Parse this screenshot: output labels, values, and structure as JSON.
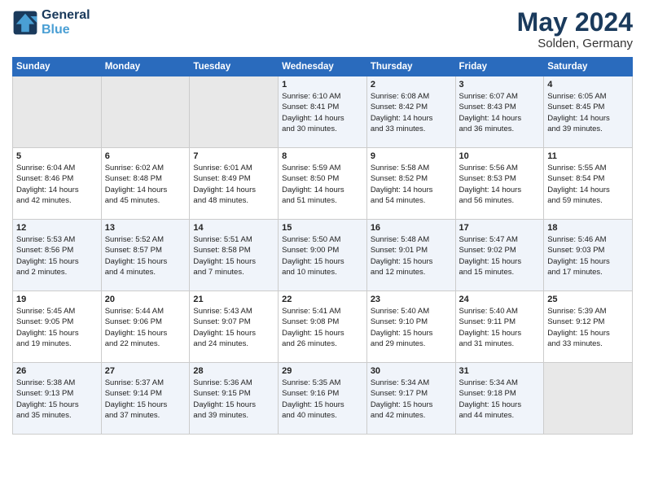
{
  "header": {
    "logo_line1": "General",
    "logo_line2": "Blue",
    "month": "May 2024",
    "location": "Solden, Germany"
  },
  "weekdays": [
    "Sunday",
    "Monday",
    "Tuesday",
    "Wednesday",
    "Thursday",
    "Friday",
    "Saturday"
  ],
  "rows": [
    [
      {
        "day": "",
        "text": ""
      },
      {
        "day": "",
        "text": ""
      },
      {
        "day": "",
        "text": ""
      },
      {
        "day": "1",
        "text": "Sunrise: 6:10 AM\nSunset: 8:41 PM\nDaylight: 14 hours\nand 30 minutes."
      },
      {
        "day": "2",
        "text": "Sunrise: 6:08 AM\nSunset: 8:42 PM\nDaylight: 14 hours\nand 33 minutes."
      },
      {
        "day": "3",
        "text": "Sunrise: 6:07 AM\nSunset: 8:43 PM\nDaylight: 14 hours\nand 36 minutes."
      },
      {
        "day": "4",
        "text": "Sunrise: 6:05 AM\nSunset: 8:45 PM\nDaylight: 14 hours\nand 39 minutes."
      }
    ],
    [
      {
        "day": "5",
        "text": "Sunrise: 6:04 AM\nSunset: 8:46 PM\nDaylight: 14 hours\nand 42 minutes."
      },
      {
        "day": "6",
        "text": "Sunrise: 6:02 AM\nSunset: 8:48 PM\nDaylight: 14 hours\nand 45 minutes."
      },
      {
        "day": "7",
        "text": "Sunrise: 6:01 AM\nSunset: 8:49 PM\nDaylight: 14 hours\nand 48 minutes."
      },
      {
        "day": "8",
        "text": "Sunrise: 5:59 AM\nSunset: 8:50 PM\nDaylight: 14 hours\nand 51 minutes."
      },
      {
        "day": "9",
        "text": "Sunrise: 5:58 AM\nSunset: 8:52 PM\nDaylight: 14 hours\nand 54 minutes."
      },
      {
        "day": "10",
        "text": "Sunrise: 5:56 AM\nSunset: 8:53 PM\nDaylight: 14 hours\nand 56 minutes."
      },
      {
        "day": "11",
        "text": "Sunrise: 5:55 AM\nSunset: 8:54 PM\nDaylight: 14 hours\nand 59 minutes."
      }
    ],
    [
      {
        "day": "12",
        "text": "Sunrise: 5:53 AM\nSunset: 8:56 PM\nDaylight: 15 hours\nand 2 minutes."
      },
      {
        "day": "13",
        "text": "Sunrise: 5:52 AM\nSunset: 8:57 PM\nDaylight: 15 hours\nand 4 minutes."
      },
      {
        "day": "14",
        "text": "Sunrise: 5:51 AM\nSunset: 8:58 PM\nDaylight: 15 hours\nand 7 minutes."
      },
      {
        "day": "15",
        "text": "Sunrise: 5:50 AM\nSunset: 9:00 PM\nDaylight: 15 hours\nand 10 minutes."
      },
      {
        "day": "16",
        "text": "Sunrise: 5:48 AM\nSunset: 9:01 PM\nDaylight: 15 hours\nand 12 minutes."
      },
      {
        "day": "17",
        "text": "Sunrise: 5:47 AM\nSunset: 9:02 PM\nDaylight: 15 hours\nand 15 minutes."
      },
      {
        "day": "18",
        "text": "Sunrise: 5:46 AM\nSunset: 9:03 PM\nDaylight: 15 hours\nand 17 minutes."
      }
    ],
    [
      {
        "day": "19",
        "text": "Sunrise: 5:45 AM\nSunset: 9:05 PM\nDaylight: 15 hours\nand 19 minutes."
      },
      {
        "day": "20",
        "text": "Sunrise: 5:44 AM\nSunset: 9:06 PM\nDaylight: 15 hours\nand 22 minutes."
      },
      {
        "day": "21",
        "text": "Sunrise: 5:43 AM\nSunset: 9:07 PM\nDaylight: 15 hours\nand 24 minutes."
      },
      {
        "day": "22",
        "text": "Sunrise: 5:41 AM\nSunset: 9:08 PM\nDaylight: 15 hours\nand 26 minutes."
      },
      {
        "day": "23",
        "text": "Sunrise: 5:40 AM\nSunset: 9:10 PM\nDaylight: 15 hours\nand 29 minutes."
      },
      {
        "day": "24",
        "text": "Sunrise: 5:40 AM\nSunset: 9:11 PM\nDaylight: 15 hours\nand 31 minutes."
      },
      {
        "day": "25",
        "text": "Sunrise: 5:39 AM\nSunset: 9:12 PM\nDaylight: 15 hours\nand 33 minutes."
      }
    ],
    [
      {
        "day": "26",
        "text": "Sunrise: 5:38 AM\nSunset: 9:13 PM\nDaylight: 15 hours\nand 35 minutes."
      },
      {
        "day": "27",
        "text": "Sunrise: 5:37 AM\nSunset: 9:14 PM\nDaylight: 15 hours\nand 37 minutes."
      },
      {
        "day": "28",
        "text": "Sunrise: 5:36 AM\nSunset: 9:15 PM\nDaylight: 15 hours\nand 39 minutes."
      },
      {
        "day": "29",
        "text": "Sunrise: 5:35 AM\nSunset: 9:16 PM\nDaylight: 15 hours\nand 40 minutes."
      },
      {
        "day": "30",
        "text": "Sunrise: 5:34 AM\nSunset: 9:17 PM\nDaylight: 15 hours\nand 42 minutes."
      },
      {
        "day": "31",
        "text": "Sunrise: 5:34 AM\nSunset: 9:18 PM\nDaylight: 15 hours\nand 44 minutes."
      },
      {
        "day": "",
        "text": ""
      }
    ]
  ]
}
